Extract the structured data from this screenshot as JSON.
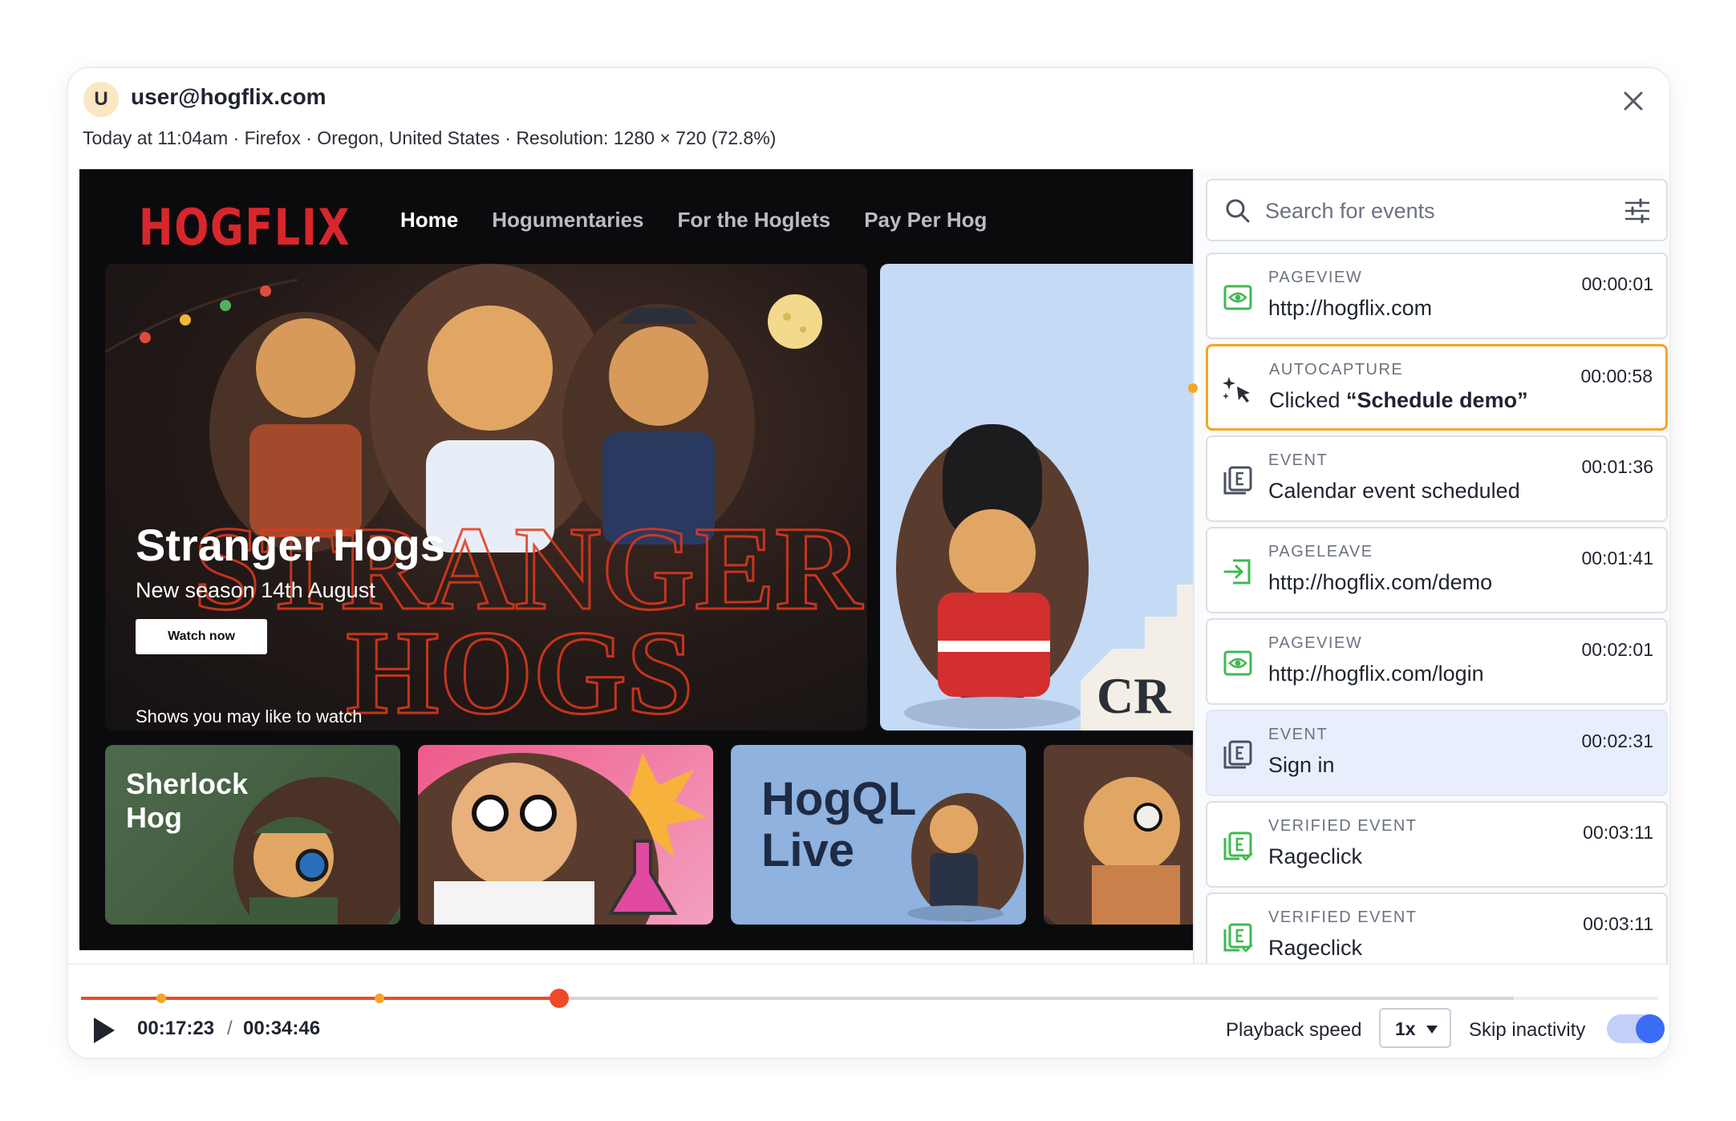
{
  "colors": {
    "accent_orange": "#f5a623",
    "progress_red": "#ef4a26",
    "toggle_blue": "#3b6cf6",
    "event_icon_green": "#3fb950",
    "hogflix_red": "#d8262c"
  },
  "header": {
    "avatar_letter": "U",
    "user_email": "user@hogflix.com",
    "session_meta": "Today at 11:04am · Firefox · Oregon, United States · Resolution: 1280 × 720 (72.8%)"
  },
  "recording": {
    "logo": "HOGFLIX",
    "nav": [
      "Home",
      "Hogumentaries",
      "For the Hoglets",
      "Pay Per Hog"
    ],
    "hero": {
      "title": "Stranger Hogs",
      "subtitle": "New season 14th August",
      "button": "Watch now",
      "row_label": "Shows you may like to watch"
    },
    "tiles": [
      "Sherlock Hog",
      "HogQL Live"
    ]
  },
  "events_panel": {
    "search_placeholder": "Search for events",
    "events": [
      {
        "type": "PAGEVIEW",
        "desc": "http://hogflix.com",
        "time": "00:00:01",
        "icon": "eye-icon"
      },
      {
        "type": "AUTOCAPTURE",
        "desc_prefix": "Clicked ",
        "desc_bold": "“Schedule demo”",
        "time": "00:00:58",
        "icon": "sparkle-cursor-icon"
      },
      {
        "type": "EVENT",
        "desc": "Calendar event scheduled",
        "time": "00:01:36",
        "icon": "event-icon"
      },
      {
        "type": "PAGELEAVE",
        "desc": "http://hogflix.com/demo",
        "time": "00:01:41",
        "icon": "exit-icon"
      },
      {
        "type": "PAGEVIEW",
        "desc": "http://hogflix.com/login",
        "time": "00:02:01",
        "icon": "eye-icon"
      },
      {
        "type": "EVENT",
        "desc": "Sign in",
        "time": "00:02:31",
        "icon": "event-icon"
      },
      {
        "type": "VERIFIED EVENT",
        "desc": "Rageclick",
        "time": "00:03:11",
        "icon": "verified-event-icon"
      },
      {
        "type": "VERIFIED EVENT",
        "desc": "Rageclick",
        "time": "00:03:11",
        "icon": "verified-event-icon"
      }
    ]
  },
  "player": {
    "current_time": "00:17:23",
    "separator": "/",
    "total_time": "00:34:46",
    "progress_fraction": 0.25,
    "speed_label": "Playback speed",
    "speed_value": "1x",
    "skip_label": "Skip inactivity",
    "skip_inactivity": true
  }
}
